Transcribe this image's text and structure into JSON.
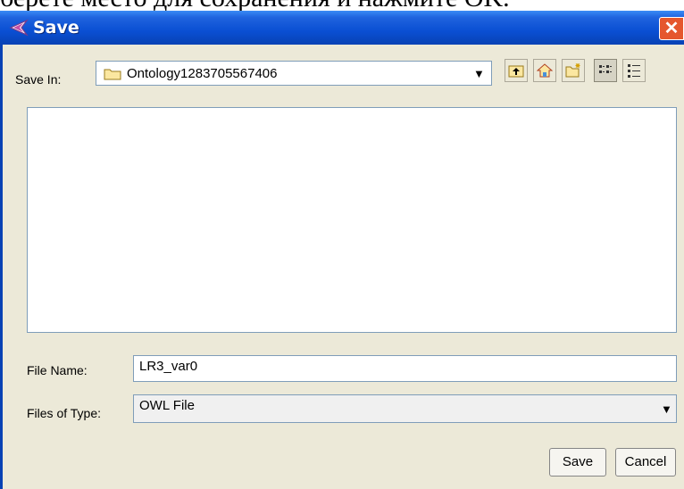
{
  "doc_text": "берете место для сохранения и нажмите OK.",
  "window": {
    "title": "Save",
    "close_glyph": "✕"
  },
  "save_in": {
    "label": "Save In:",
    "value": "Ontology1283705567406"
  },
  "toolbar": {
    "up_icon": "up-folder-icon",
    "home_icon": "home-icon",
    "new_folder_icon": "new-folder-icon",
    "list_view_icon": "list-view-icon",
    "details_view_icon": "details-view-icon"
  },
  "file_name": {
    "label": "File Name:",
    "value": "LR3_var0"
  },
  "file_type": {
    "label": "Files of Type:",
    "value": "OWL File"
  },
  "buttons": {
    "save": "Save",
    "cancel": "Cancel"
  },
  "colors": {
    "titlebar": "#0a4fd3",
    "dialog_bg": "#ece9d8",
    "close": "#e5572e"
  }
}
